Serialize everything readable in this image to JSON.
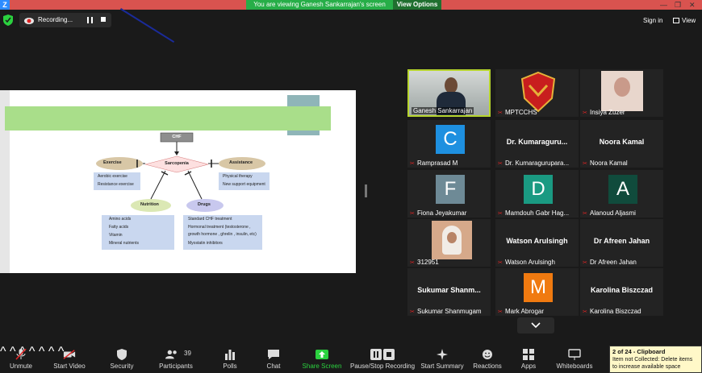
{
  "top_bar": {
    "logo": "Z",
    "share_banner": "You are viewing Ganesh Sankarrajan's screen",
    "view_options": "View Options"
  },
  "recording": {
    "label": "Recording..."
  },
  "header_right": {
    "sign_in": "Sign in",
    "view": "View"
  },
  "slide": {
    "center_node": "CHF",
    "main_node": "Sarcopenia",
    "exercise": {
      "title": "Exercise",
      "items": [
        "Aerobic exercise",
        "Resistance exercise"
      ]
    },
    "assistance": {
      "title": "Assistance",
      "items": [
        "Physical therapy",
        "New support equipment"
      ]
    },
    "nutrition": {
      "title": "Nutrition",
      "items": [
        "Amino acids",
        "Fatty acids",
        "Vitamin",
        "Mineral nutrients"
      ]
    },
    "drugs": {
      "title": "Drugs",
      "items": [
        "Standard CHF  treatment",
        "Hormonal treatment   (testosterone ,",
        "growth hormone , ghrelin , insulin, etc)",
        "Myostatin inhibitors"
      ]
    }
  },
  "gallery": [
    {
      "name": "Ganesh Sankarrajan",
      "type": "video",
      "muted": false,
      "active": true
    },
    {
      "name": "MPTCCHS",
      "type": "logo",
      "muted": true
    },
    {
      "name": "Insiya Zuzer",
      "type": "photo",
      "muted": true
    },
    {
      "name": "Ramprasad M",
      "type": "letter",
      "letter": "C",
      "color": "#1e90e0",
      "muted": true
    },
    {
      "name": "Dr. Kumaragurupara...",
      "big": "Dr.  Kumaraguru...",
      "type": "bigname",
      "muted": true
    },
    {
      "name": "Noora Kamal",
      "big": "Noora Kamal",
      "type": "bigname",
      "muted": true
    },
    {
      "name": "Fiona Jeyakumar",
      "type": "letter",
      "letter": "F",
      "color": "#6e8a96",
      "muted": true
    },
    {
      "name": "Mamdouh Gabr Hag...",
      "type": "letter",
      "letter": "D",
      "color": "#1a9a82",
      "muted": true
    },
    {
      "name": "Alanoud Aljasmi",
      "type": "letter",
      "letter": "A",
      "color": "#104b3c",
      "muted": true
    },
    {
      "name": "312951",
      "type": "photo2",
      "muted": true
    },
    {
      "name": "Watson Arulsingh",
      "big": "Watson Arulsingh",
      "type": "bigname",
      "muted": true
    },
    {
      "name": "Dr Afreen Jahan",
      "big": "Dr Afreen Jahan",
      "type": "bigname",
      "muted": true
    },
    {
      "name": "Sukumar Shanmugam",
      "big": "Sukumar  Shanm...",
      "type": "bigname",
      "muted": true
    },
    {
      "name": "Mark Abrogar",
      "type": "letter",
      "letter": "M",
      "color": "#f07a10",
      "muted": true
    },
    {
      "name": "Karolina Biszczad",
      "big": "Karolina Biszczad",
      "type": "bigname",
      "muted": true
    }
  ],
  "toolbar": {
    "unmute": "Unmute",
    "start_video": "Start Video",
    "security": "Security",
    "participants": "Participants",
    "participants_count": "39",
    "polls": "Polls",
    "chat": "Chat",
    "share_screen": "Share Screen",
    "pause_stop_recording": "Pause/Stop Recording",
    "start_summary": "Start Summary",
    "reactions": "Reactions",
    "apps": "Apps",
    "whiteboards": "Whiteboards"
  },
  "clipboard_tooltip": {
    "title": "2 of 24 - Clipboard",
    "line1": "Item not Collected: Delete items",
    "line2": "to increase available space"
  },
  "colors": {
    "accent_green": "#2bd13f",
    "banner_green": "#27ae48",
    "active_border": "#b6d42c",
    "muted_red": "#e02424"
  }
}
